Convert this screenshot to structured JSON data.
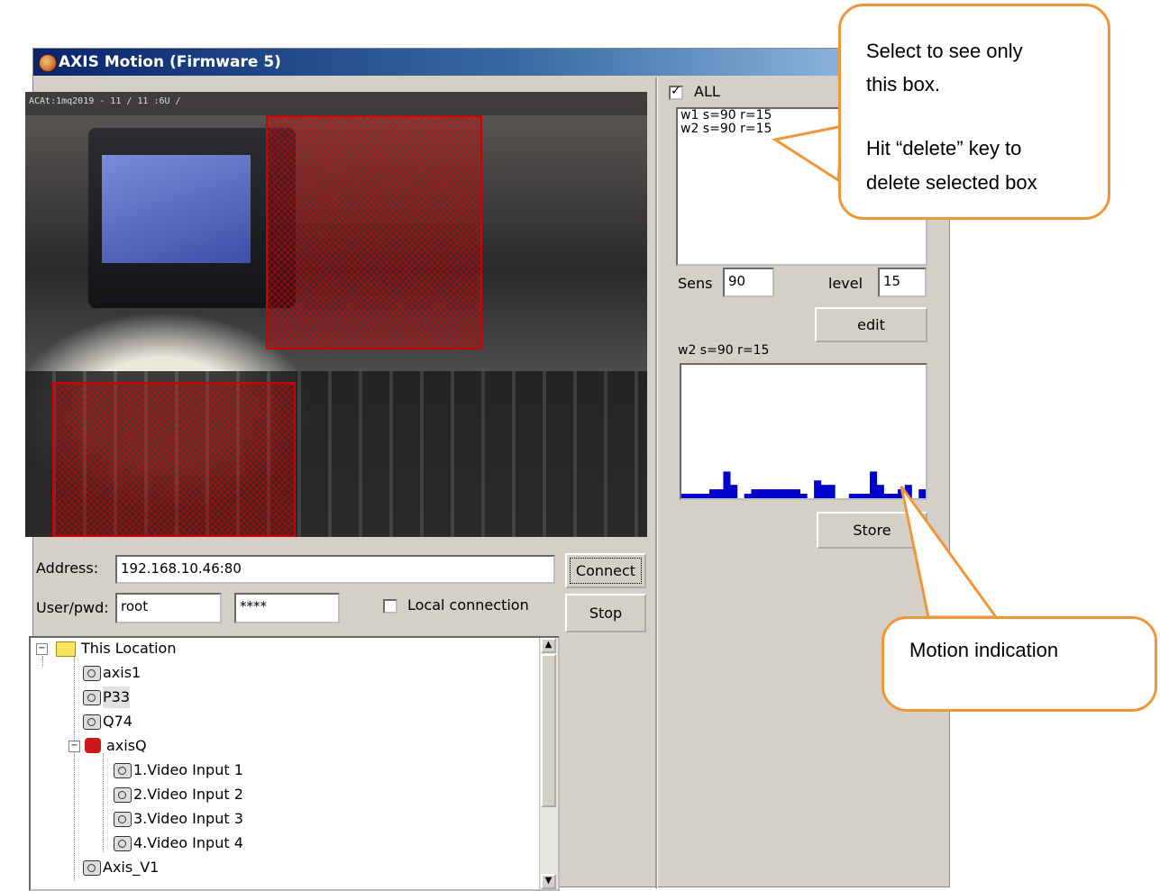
{
  "window": {
    "title": "AXIS Motion (Firmware 5)"
  },
  "video": {
    "timestamp": "ACAt:1mq2019 - 11 / 11 :6U /"
  },
  "connection": {
    "address_label": "Address:",
    "address_value": "192.168.10.46:80",
    "user_label": "User/pwd:",
    "user_value": "root",
    "password_value": "****",
    "local_label": "Local connection",
    "local_checked": false,
    "connect_label": "Connect",
    "stop_label": "Stop"
  },
  "tree": {
    "items": [
      {
        "label": "This Location"
      },
      {
        "label": "axis1"
      },
      {
        "label": "P33"
      },
      {
        "label": "Q74"
      },
      {
        "label": "axisQ"
      },
      {
        "label": "1.Video Input 1"
      },
      {
        "label": "2.Video Input 2"
      },
      {
        "label": "3.Video Input 3"
      },
      {
        "label": "4.Video Input 4"
      },
      {
        "label": "Axis_V1"
      }
    ]
  },
  "windows_panel": {
    "all_label": "ALL",
    "all_checked": true,
    "list": [
      "w1 s=90  r=15",
      "w2 s=90  r=15"
    ],
    "sens_label": "Sens",
    "sens_value": "90",
    "level_label": "level",
    "level_value": "15",
    "edit_label": "edit",
    "selected_label": "w2 s=90  r=15",
    "store_label": "Store"
  },
  "chart_data": {
    "type": "bar",
    "values": [
      1,
      1,
      1,
      1,
      2,
      2,
      6,
      3,
      0,
      1,
      2,
      2,
      2,
      2,
      2,
      2,
      2,
      1,
      0,
      4,
      3,
      3,
      0,
      0,
      1,
      1,
      1,
      6,
      3,
      1,
      1,
      2,
      3,
      0,
      2
    ],
    "color": "#0000cc"
  },
  "callouts": {
    "select_line1": "Select to see only",
    "select_line2": "this box.",
    "delete_line1": "Hit “delete” key to",
    "delete_line2": "delete selected box",
    "motion": "Motion indication"
  },
  "colors": {
    "callout_border": "#f0963a",
    "motion_box": "#d00000",
    "bar": "#0000cc"
  }
}
